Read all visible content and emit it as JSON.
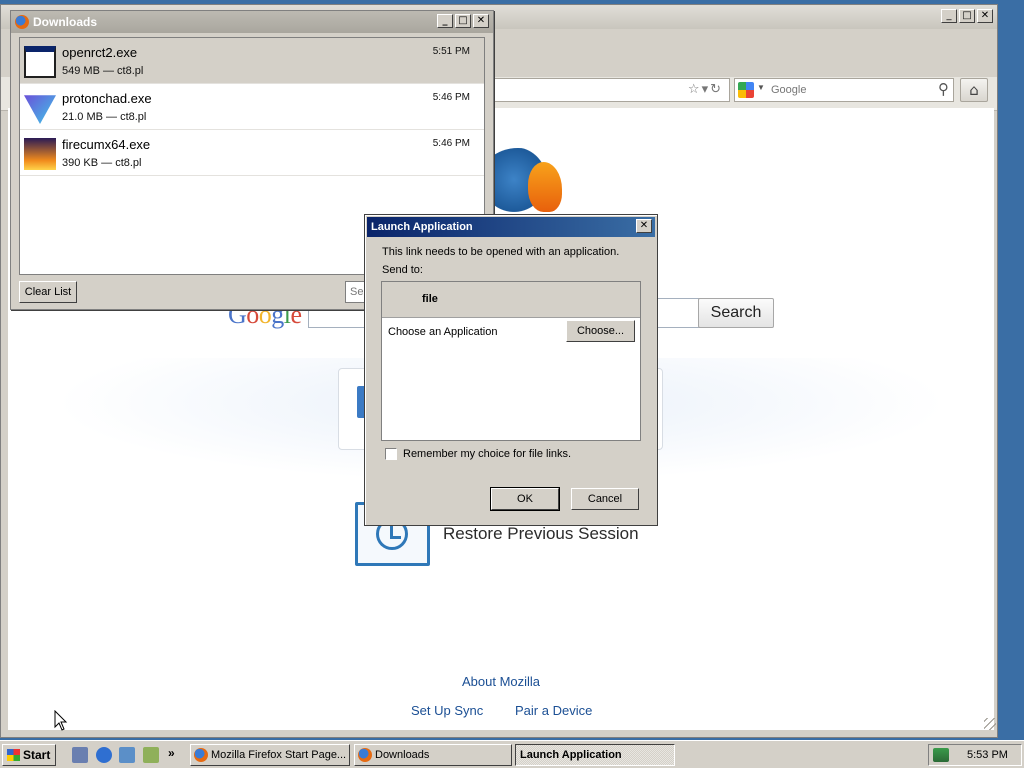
{
  "browser": {
    "search_placeholder": "Google",
    "content": {
      "google_logo": [
        "G",
        "o",
        "o",
        "g",
        "l",
        "e"
      ],
      "google_search_button": "Search",
      "restore_session": "Restore Previous Session",
      "about_mozilla": "About Mozilla",
      "set_up_sync": "Set Up Sync",
      "pair_device": "Pair a Device"
    }
  },
  "downloads": {
    "title": "Downloads",
    "items": [
      {
        "name": "openrct2.exe",
        "meta": "549 MB — ct8.pl",
        "time": "5:51 PM",
        "icon": "exe-window-icon"
      },
      {
        "name": "protonchad.exe",
        "meta": "21.0 MB — ct8.pl",
        "time": "5:46 PM",
        "icon": "proton-icon"
      },
      {
        "name": "firecumx64.exe",
        "meta": "390 KB — ct8.pl",
        "time": "5:46 PM",
        "icon": "firecum-icon"
      }
    ],
    "clear_list": "Clear List",
    "search_placeholder": "Se"
  },
  "launch_dialog": {
    "title": "Launch Application",
    "message": "This link needs to be opened with an application.",
    "send_to": "Send to:",
    "header": "file",
    "choose_label": "Choose an Application",
    "choose_button": "Choose...",
    "remember": "Remember my choice for file links.",
    "remember_checked": false,
    "ok": "OK",
    "cancel": "Cancel"
  },
  "taskbar": {
    "start": "Start",
    "tasks": [
      "Mozilla Firefox Start Page...",
      "Downloads",
      "Launch Application"
    ],
    "active_task": "Launch Application",
    "overflow": "»",
    "clock": "5:53 PM"
  }
}
